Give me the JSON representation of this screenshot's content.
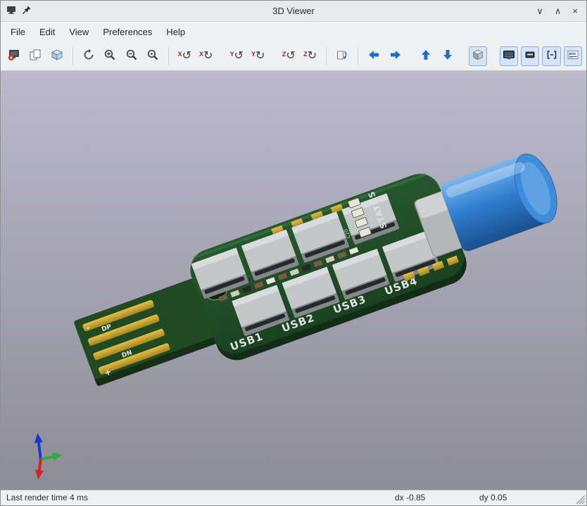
{
  "window": {
    "title": "3D Viewer",
    "controls": {
      "minimize": "∨",
      "maximize": "∧",
      "close": "×"
    }
  },
  "menubar": {
    "items": [
      "File",
      "Edit",
      "View",
      "Preferences",
      "Help"
    ]
  },
  "toolbar": {
    "glyphs": {
      "axis_x": "X",
      "axis_y": "Y",
      "axis_z": "Z",
      "rotate_ccw": "↺",
      "rotate_cw": "↻"
    }
  },
  "viewport": {
    "board": {
      "usb_labels": [
        "USB1",
        "USB2",
        "USB3",
        "USB4"
      ],
      "status_label": "STATUS",
      "cap_ref": "C20",
      "plug": {
        "dp": "DP",
        "dn": "DN",
        "plus": "+",
        "minus": "-"
      }
    },
    "colors": {
      "background_top": "#bbb9cb",
      "background_bottom": "#8d8c97",
      "pcb_green": "#1d4a24",
      "gold": "#c9a227",
      "connector_silver": "#c3c7c8",
      "capacitor_blue": "#2f7fd0",
      "axis_x_red": "#d62222",
      "axis_y_green": "#2fae2f",
      "axis_z_blue": "#2038d0",
      "pan_arrow_blue": "#1e6ed2"
    }
  },
  "statusbar": {
    "render_time": "Last render time 4 ms",
    "dx": "dx -0.85",
    "dy": "dy 0.05"
  }
}
